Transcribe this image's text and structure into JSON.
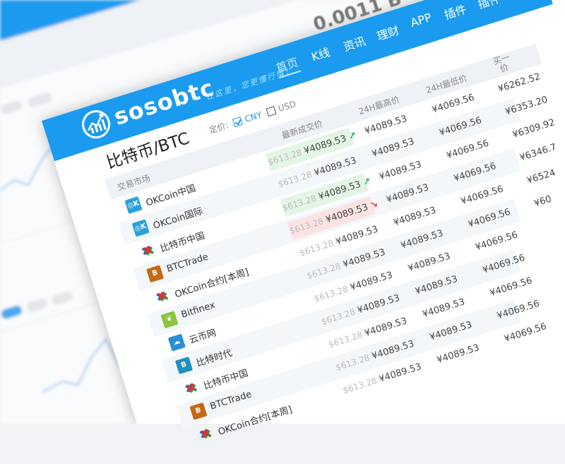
{
  "background": {
    "big_value": "0.0011 B"
  },
  "header": {
    "logo_text": "sosobtc",
    "tagline": "在这里，您更懂行情！",
    "nav": [
      {
        "label": "首页",
        "active": true
      },
      {
        "label": "K线"
      },
      {
        "label": "资讯"
      },
      {
        "label": "理财"
      },
      {
        "label": "APP"
      },
      {
        "label": "插件"
      },
      {
        "label": "插件"
      }
    ]
  },
  "page": {
    "title": "比特币/BTC",
    "pricing_label": "定价:",
    "currency_options": [
      {
        "label": "CNY",
        "checked": true
      },
      {
        "label": "USD",
        "checked": false
      }
    ]
  },
  "table": {
    "columns": [
      "交易市场",
      "最新成交价",
      "24H最高价",
      "24H最低价",
      "买一价"
    ],
    "rows": [
      {
        "market": "OKCoin中国",
        "icon": "okcoin-logo",
        "usd": "$613.28",
        "price": "¥4089.53",
        "trend": "up",
        "high": "¥4089.53",
        "low": "¥4069.56",
        "buy": "¥6262.52"
      },
      {
        "market": "OKCoin国际",
        "icon": "okcoin-logo",
        "usd": "$613.28",
        "price": "¥4089.53",
        "trend": "",
        "high": "¥4089.53",
        "low": "¥4069.56",
        "buy": "¥6353.20"
      },
      {
        "market": "比特币中国",
        "icon": "btcchina-logo",
        "usd": "$613.28",
        "price": "¥4089.53",
        "trend": "up",
        "high": "¥4089.53",
        "low": "¥4069.56",
        "buy": "¥6309.92"
      },
      {
        "market": "BTCTrade",
        "icon": "btctrade-logo",
        "usd": "$613.28",
        "price": "¥4089.53",
        "trend": "down",
        "high": "¥4089.53",
        "low": "¥4069.56",
        "buy": "¥6346.7"
      },
      {
        "market": "OKCoin合约[本周]",
        "icon": "okcoin-futures-logo",
        "usd": "$613.28",
        "price": "¥4089.53",
        "trend": "",
        "high": "¥4089.53",
        "low": "¥4069.56",
        "buy": "¥6524"
      },
      {
        "market": "Bitfinex",
        "icon": "bitfinex-logo",
        "usd": "$613.28",
        "price": "¥4089.53",
        "trend": "",
        "high": "¥4089.53",
        "low": "¥4069.56",
        "buy": "¥60"
      },
      {
        "market": "云币网",
        "icon": "yunbi-logo",
        "usd": "$613.28",
        "price": "¥4089.53",
        "trend": "",
        "high": "¥4089.53",
        "low": "¥4069.56",
        "buy": ""
      },
      {
        "market": "比特时代",
        "icon": "btc38-logo",
        "usd": "$613.28",
        "price": "¥4089.53",
        "trend": "",
        "high": "¥4089.53",
        "low": "¥4069.56",
        "buy": ""
      },
      {
        "market": "比特币中国",
        "icon": "btcchina-logo",
        "usd": "$613.28",
        "price": "¥4089.53",
        "trend": "",
        "high": "¥4089.53",
        "low": "¥4069.56",
        "buy": ""
      },
      {
        "market": "BTCTrade",
        "icon": "btctrade-logo",
        "usd": "$613.28",
        "price": "¥4089.53",
        "trend": "",
        "high": "¥4089.53",
        "low": "¥4069.56",
        "buy": ""
      },
      {
        "market": "OKCoin合约[本周]",
        "icon": "okcoin-futures-logo",
        "usd": "$613.28",
        "price": "¥4089.53",
        "trend": "",
        "high": "¥4089.53",
        "low": "¥4069.56",
        "buy": ""
      }
    ],
    "trend_arrows": {
      "up": "↗",
      "down": "↘"
    }
  },
  "colors": {
    "brand": "#1a9bf0",
    "up_bg": "#e3f6e5",
    "up": "#2bb24c",
    "down_bg": "#fce3e3",
    "down": "#e24040"
  }
}
